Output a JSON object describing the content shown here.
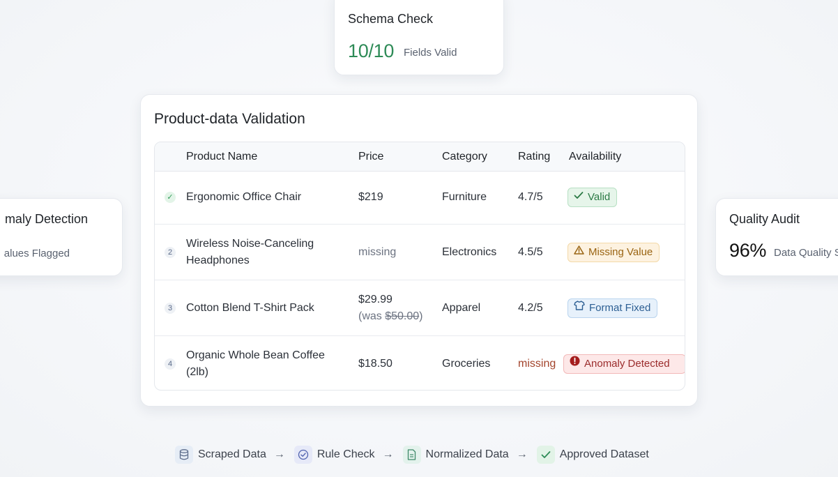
{
  "schema_card": {
    "title": "Schema Check",
    "value": "10/10",
    "caption": "Fields Valid"
  },
  "anomaly_card": {
    "title": "maly Detection",
    "caption": "alues Flagged"
  },
  "quality_card": {
    "title": "Quality Audit",
    "value": "96%",
    "caption": "Data Quality S"
  },
  "main": {
    "title": "Product-data Validation",
    "columns": {
      "name": "Product Name",
      "price": "Price",
      "category": "Category",
      "rating": "Rating",
      "availability": "Availability"
    },
    "rows": [
      {
        "marker": "✓",
        "name_line1": "Ergonomic Office Chair",
        "name_line2": "",
        "price": "$219",
        "price_note_prefix": "",
        "price_note_strike": "",
        "price_note_suffix": "",
        "category": "Furniture",
        "rating": "4.7/5",
        "badge": "Valid",
        "badge_icon": "check-icon"
      },
      {
        "marker": "2",
        "name_line1": "Wireless Noise-Canceling",
        "name_line2": "Headphones",
        "price": "missing",
        "category": "Electronics",
        "rating": "4.5/5",
        "badge": "Missing Value",
        "badge_icon": "warning-icon"
      },
      {
        "marker": "3",
        "name_line1": "Cotton Blend T-Shirt Pack",
        "name_line2": "",
        "price": "$29.99",
        "price_note_prefix": "(was ",
        "price_note_strike": "$50.00",
        "price_note_suffix": ")",
        "category": "Apparel",
        "rating": "4.2/5",
        "badge": "Format Fixed",
        "badge_icon": "shirt-icon"
      },
      {
        "marker": "4",
        "name_line1": "Organic Whole Bean Coffee",
        "name_line2": "(2lb)",
        "price": "$18.50",
        "category": "Groceries",
        "rating": "missing",
        "badge": "Anomaly Detected",
        "badge_icon": "alert-circle-icon"
      }
    ]
  },
  "pipeline": {
    "steps": [
      {
        "label": "Scraped Data",
        "icon": "database-icon"
      },
      {
        "label": "Rule Check",
        "icon": "check-circle-icon"
      },
      {
        "label": "Normalized Data",
        "icon": "document-icon"
      },
      {
        "label": "Approved Dataset",
        "icon": "check-icon"
      }
    ],
    "arrow": "→"
  },
  "colors": {
    "success": "#2e8b57",
    "warning": "#9a6412",
    "info": "#2d5f93",
    "danger": "#9b2c2c"
  }
}
